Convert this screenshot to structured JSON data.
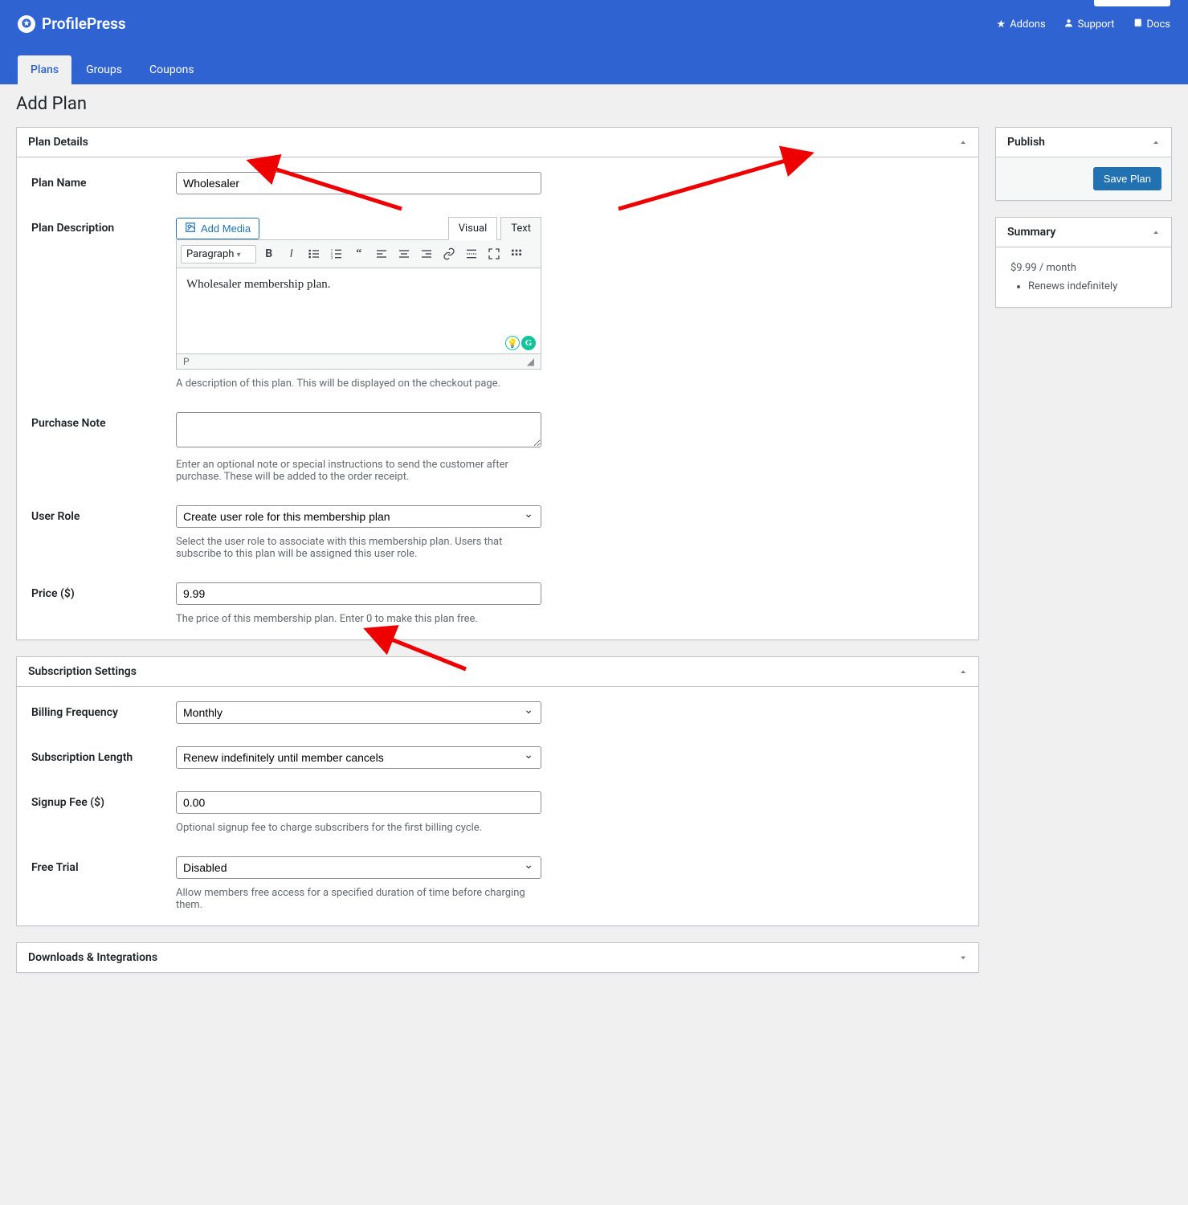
{
  "brand": "ProfilePress",
  "toplinks": {
    "addons": "Addons",
    "support": "Support",
    "docs": "Docs"
  },
  "tabs": {
    "plans": "Plans",
    "groups": "Groups",
    "coupons": "Coupons"
  },
  "page_title": "Add Plan",
  "publish": {
    "title": "Publish",
    "save_btn": "Save Plan"
  },
  "summary": {
    "title": "Summary",
    "price_line": "$9.99 / month",
    "bullet1": "Renews indefinitely"
  },
  "plan_details": {
    "title": "Plan Details",
    "name_label": "Plan Name",
    "name_value": "Wholesaler",
    "desc_label": "Plan Description",
    "add_media": "Add Media",
    "tab_visual": "Visual",
    "tab_text": "Text",
    "format": "Paragraph",
    "desc_value": "Wholesaler membership plan.",
    "status_path": "P",
    "desc_help": "A description of this plan. This will be displayed on the checkout page.",
    "note_label": "Purchase Note",
    "note_help": "Enter an optional note or special instructions to send the customer after purchase. These will be added to the order receipt.",
    "role_label": "User Role",
    "role_value": "Create user role for this membership plan",
    "role_help": "Select the user role to associate with this membership plan. Users that subscribe to this plan will be assigned this user role.",
    "price_label": "Price ($)",
    "price_value": "9.99",
    "price_help": "The price of this membership plan. Enter 0 to make this plan free."
  },
  "subscription": {
    "title": "Subscription Settings",
    "freq_label": "Billing Frequency",
    "freq_value": "Monthly",
    "len_label": "Subscription Length",
    "len_value": "Renew indefinitely until member cancels",
    "fee_label": "Signup Fee ($)",
    "fee_value": "0.00",
    "fee_help": "Optional signup fee to charge subscribers for the first billing cycle.",
    "trial_label": "Free Trial",
    "trial_value": "Disabled",
    "trial_help": "Allow members free access for a specified duration of time before charging them."
  },
  "downloads": {
    "title": "Downloads & Integrations"
  }
}
